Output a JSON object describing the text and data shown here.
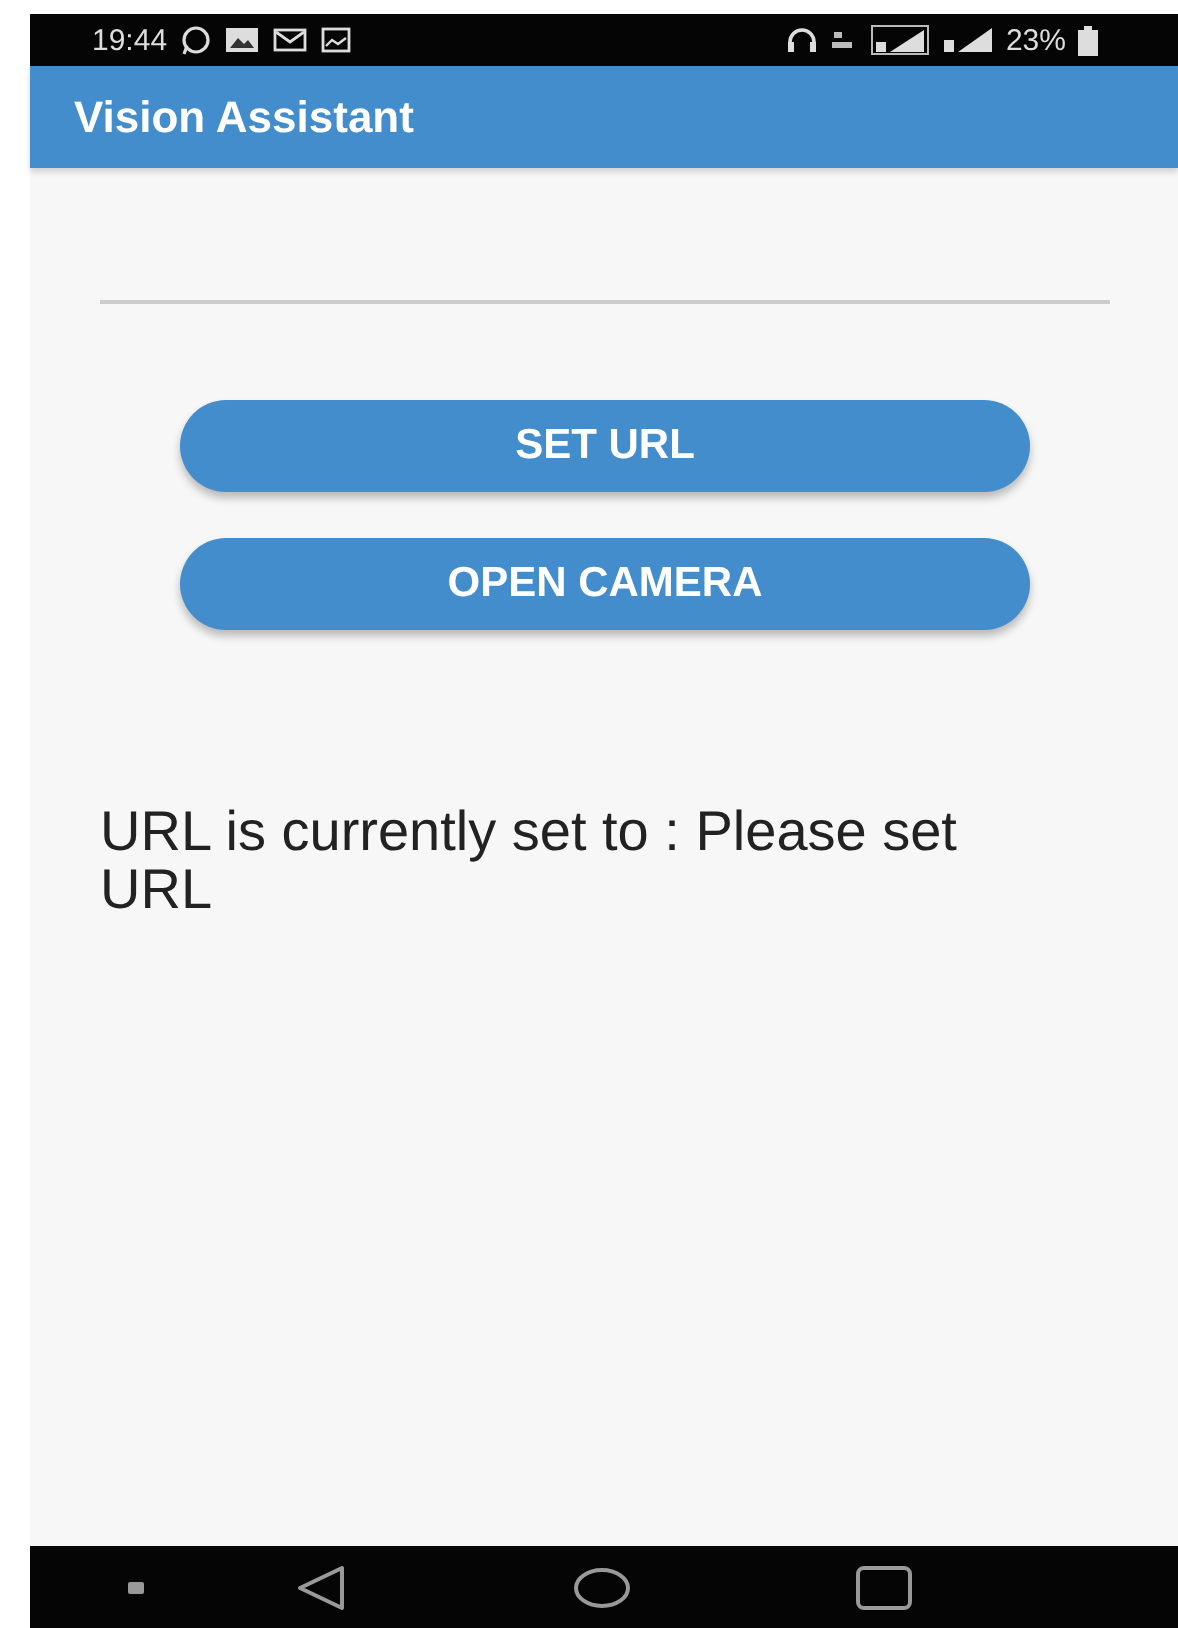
{
  "status_bar": {
    "time": "19:44",
    "battery": "23%"
  },
  "app_bar": {
    "title": "Vision Assistant"
  },
  "url_field": {
    "focused": false
  },
  "buttons": [
    "SET URL",
    "OPEN CAMERA"
  ],
  "message": "URL is currently set to : Please set URL"
}
